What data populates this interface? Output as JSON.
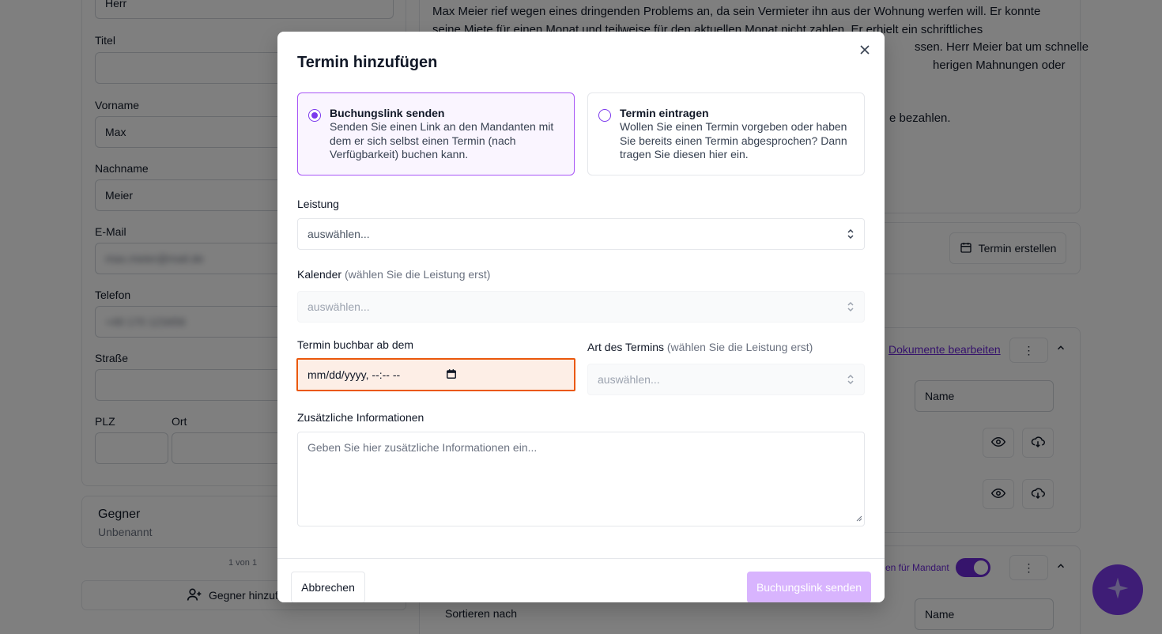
{
  "background": {
    "salutation_value": "Herr",
    "title_label": "Titel",
    "firstname_label": "Vorname",
    "firstname_value": "Max",
    "lastname_label": "Nachname",
    "lastname_value": "Meier",
    "email_label": "E-Mail",
    "email_value": "max.meier@mail.de",
    "phone_label": "Telefon",
    "phone_value": "+49 170 123456",
    "street_label": "Straße",
    "zip_label": "PLZ",
    "city_label": "Ort",
    "opponent_title": "Gegner",
    "opponent_subtitle": "Unbenannt",
    "page_count": "1 von 1",
    "add_opponent_label": "Gegner hinzufü",
    "case_text_1": "Max Meier rief wegen eines dringenden Problems an, da sein Vermieter ihn aus der Wohnung werfen will. Er konnte",
    "case_text_2": "seine Miete für einen Monat und teilweise für den aktuellen Monat nicht zahlen. Er erhielt ein schriftliches",
    "case_text_3": "ssen. Herr Meier bat um schnelle",
    "case_text_4": "herigen Mahnungen oder",
    "case_text_5": "e bezahlen.",
    "create_appointment_label": "Termin erstellen",
    "edit_documents_label": "Dokumente bearbeiten",
    "sort_name_1": "Name",
    "visible_for_client_label": "en für Mandant",
    "sort_by_label": "Sortieren nach",
    "sort_name_2": "Name"
  },
  "modal": {
    "title": "Termin hinzufügen",
    "options": [
      {
        "title": "Buchungslink senden",
        "description": "Senden Sie einen Link an den Mandanten mit dem er sich selbst einen Termin (nach Verfügbarkeit) buchen kann.",
        "selected": true
      },
      {
        "title": "Termin eintragen",
        "description": "Wollen Sie einen Termin vorgeben oder haben Sie bereits einen Termin abgesprochen? Dann tragen Sie diesen hier ein.",
        "selected": false
      }
    ],
    "service": {
      "label": "Leistung",
      "placeholder": "auswählen..."
    },
    "calendar": {
      "label": "Kalender",
      "hint": "(wählen Sie die Leistung erst)",
      "placeholder": "auswählen..."
    },
    "bookable_from": {
      "label": "Termin buchbar ab dem",
      "placeholder": "mm/dd/yyyy, --:-- --"
    },
    "appointment_type": {
      "label": "Art des Termins",
      "hint": "(wählen Sie die Leistung erst)",
      "placeholder": "auswählen..."
    },
    "additional_info": {
      "label": "Zusätzliche Informationen",
      "placeholder": "Geben Sie hier zusätzliche Informationen ein..."
    },
    "cancel_label": "Abbrechen",
    "submit_label": "Buchungslink senden"
  },
  "colors": {
    "accent": "#7c3aed",
    "selected_border": "#a855f7",
    "selected_bg": "#faf5ff",
    "error_border": "#ea580c",
    "error_bg": "#fdeee6",
    "submit_disabled": "#d8b4fe"
  }
}
